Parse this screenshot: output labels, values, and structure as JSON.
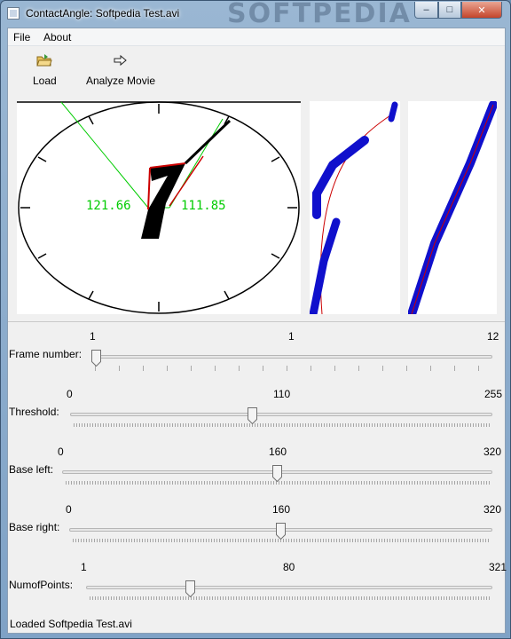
{
  "window": {
    "title": "ContactAngle: Softpedia Test.avi",
    "watermark": "SOFTPEDIA"
  },
  "titlebar_buttons": {
    "minimize": "–",
    "maximize": "□",
    "close": "✕"
  },
  "menu": [
    {
      "label": "File"
    },
    {
      "label": "About"
    }
  ],
  "toolbar": {
    "load": {
      "label": "Load",
      "icon": "folder-open-icon"
    },
    "analyze": {
      "label": "Analyze Movie",
      "icon": "arrow-right-icon"
    }
  },
  "views": {
    "main": {
      "angle_left": "121.66",
      "angle_right": "111.85"
    },
    "colors": {
      "fit": "#00cc00",
      "edge": "#cc0000",
      "points": "#0000cc"
    }
  },
  "sliders": [
    {
      "label": "Frame number:",
      "min": "1",
      "current": "1",
      "max": "12",
      "fraction": 0.0
    },
    {
      "label": "Threshold:",
      "min": "0",
      "current": "110",
      "max": "255",
      "fraction": 0.43
    },
    {
      "label": "Base left:",
      "min": "0",
      "current": "160",
      "max": "320",
      "fraction": 0.5
    },
    {
      "label": "Base right:",
      "min": "0",
      "current": "160",
      "max": "320",
      "fraction": 0.5
    },
    {
      "label": "NumofPoints:",
      "min": "1",
      "current": "80",
      "max": "321",
      "fraction": 0.25
    }
  ],
  "status": "Loaded Softpedia Test.avi"
}
